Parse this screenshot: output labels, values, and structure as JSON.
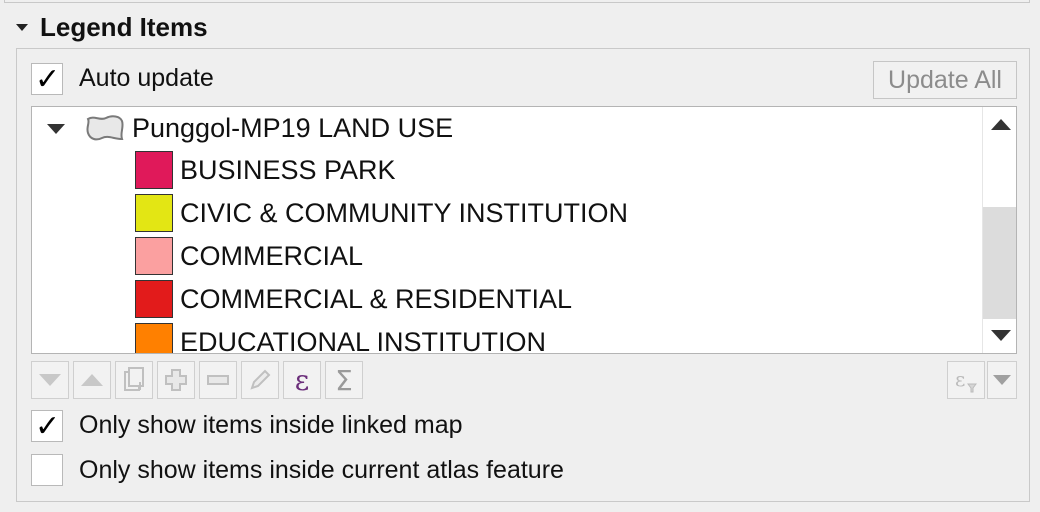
{
  "section": {
    "title": "Legend Items"
  },
  "auto_update": {
    "label": "Auto update",
    "checked": true
  },
  "update_all_label": "Update All",
  "tree": {
    "layer_name": "Punggol-MP19 LAND USE",
    "items": [
      {
        "label": "BUSINESS PARK",
        "color": "#e0195a"
      },
      {
        "label": "CIVIC & COMMUNITY INSTITUTION",
        "color": "#e3e614"
      },
      {
        "label": "COMMERCIAL",
        "color": "#fba0a0"
      },
      {
        "label": "COMMERCIAL & RESIDENTIAL",
        "color": "#e21b1b"
      },
      {
        "label": "EDUCATIONAL INSTITUTION",
        "color": "#ff8000"
      }
    ]
  },
  "toolbar": {
    "icons": [
      "move-down-icon",
      "move-up-icon",
      "add-group-icon",
      "add-item-icon",
      "remove-item-icon",
      "edit-item-icon",
      "expression-icon",
      "sum-icon"
    ],
    "expression_glyph": "ε",
    "sum_glyph": "Σ"
  },
  "options": {
    "linked_map": {
      "label": "Only show items inside linked map",
      "checked": true
    },
    "atlas_feature": {
      "label": "Only show items inside current atlas feature",
      "checked": false
    }
  },
  "colors": {
    "accent_expression": "#6b2e7a"
  }
}
